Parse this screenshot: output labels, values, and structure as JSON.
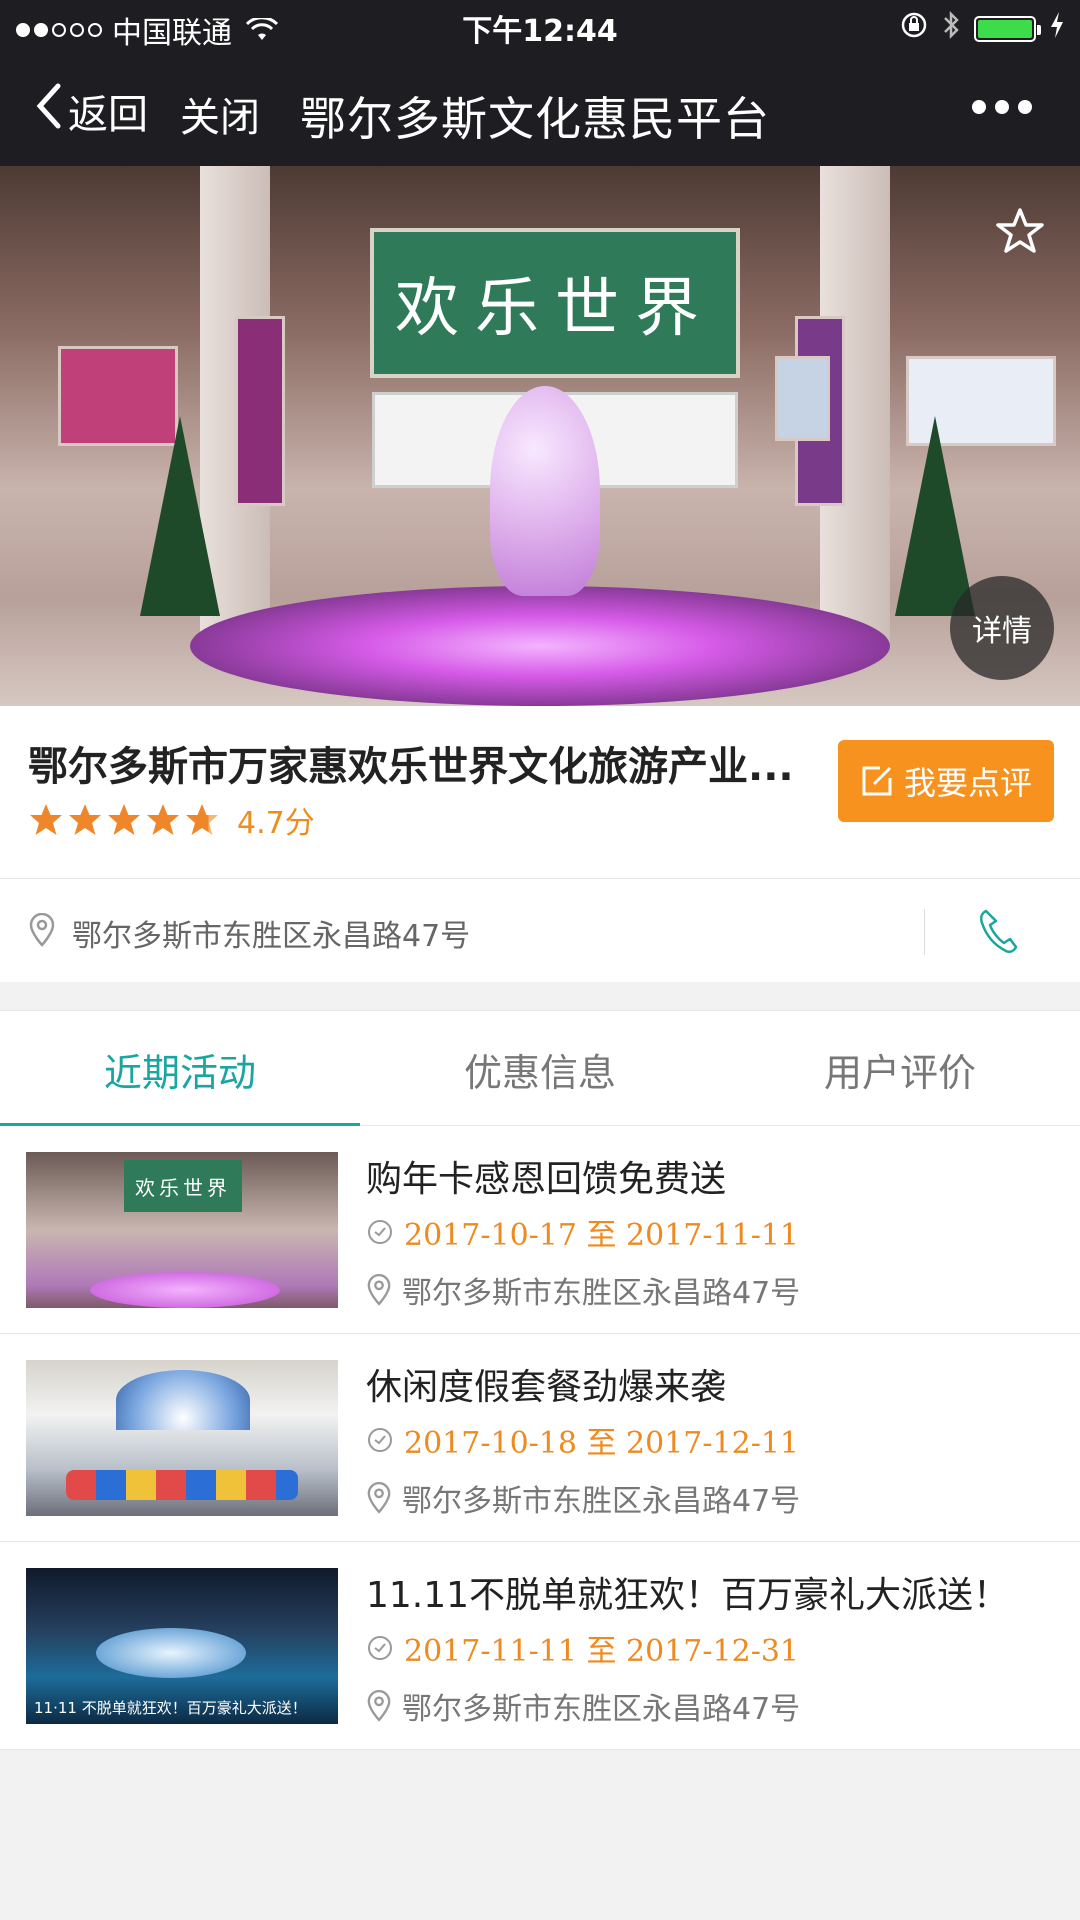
{
  "status_bar": {
    "carrier": "中国联通",
    "time": "下午12:44"
  },
  "nav": {
    "back_label": "返回",
    "close_label": "关闭",
    "title": "鄂尔多斯文化惠民平台"
  },
  "hero": {
    "sign_text": "欢乐世界",
    "detail_label": "详情"
  },
  "venue": {
    "name": "鄂尔多斯市万家惠欢乐世界文化旅游产业...",
    "rating_stars": 4.7,
    "score_text": "4.7分",
    "review_button_label": "我要点评",
    "address": "鄂尔多斯市东胜区永昌路47号"
  },
  "tabs": [
    {
      "label": "近期活动",
      "active": true
    },
    {
      "label": "优惠信息",
      "active": false
    },
    {
      "label": "用户评价",
      "active": false
    }
  ],
  "activities": [
    {
      "title": "购年卡感恩回馈免费送",
      "date": "2017-10-17 至 2017-11-11",
      "address": "鄂尔多斯市东胜区永昌路47号",
      "thumb_sign": "欢乐世界"
    },
    {
      "title": "休闲度假套餐劲爆来袭",
      "date": "2017-10-18 至 2017-12-11",
      "address": "鄂尔多斯市东胜区永昌路47号"
    },
    {
      "title": "11.11不脱单就狂欢！百万豪礼大派送！",
      "date": "2017-11-11 至 2017-12-31",
      "address": "鄂尔多斯市东胜区永昌路47号",
      "thumb_caption": "11·11 不脱单就狂欢！百万豪礼大派送！"
    }
  ],
  "colors": {
    "accent_teal": "#1aa6a0",
    "accent_orange": "#f7921e",
    "date_orange": "#ee8a1f",
    "topbar_bg": "#1e1e22"
  },
  "icons": [
    "wifi-icon",
    "lock-rotation-icon",
    "bluetooth-icon",
    "battery-icon",
    "charging-icon",
    "back-chevron-icon",
    "more-icon",
    "star-outline-icon",
    "star-icon",
    "edit-icon",
    "location-pin-icon",
    "phone-icon",
    "clock-icon"
  ]
}
